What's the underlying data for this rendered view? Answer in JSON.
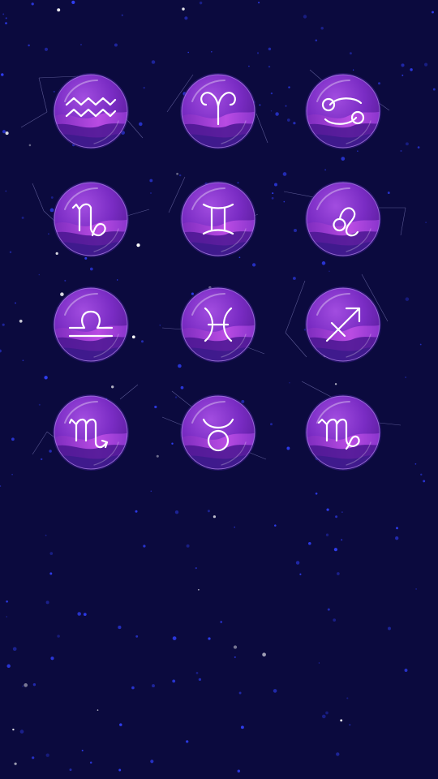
{
  "colors": {
    "background": "#0b0a3e",
    "star_blue": "#2f3df0",
    "star_white": "#ffffff",
    "orb_top": "#a24de0",
    "orb_bottom": "#5a1c9c",
    "wave_pink": "#c04fe6",
    "glyph": "#ffffff"
  },
  "signs": [
    {
      "name": "aquarius",
      "icon": "aquarius-icon"
    },
    {
      "name": "aries",
      "icon": "aries-icon"
    },
    {
      "name": "cancer",
      "icon": "cancer-icon"
    },
    {
      "name": "capricorn",
      "icon": "capricorn-icon"
    },
    {
      "name": "gemini",
      "icon": "gemini-icon"
    },
    {
      "name": "leo",
      "icon": "leo-icon"
    },
    {
      "name": "libra",
      "icon": "libra-icon"
    },
    {
      "name": "pisces",
      "icon": "pisces-icon"
    },
    {
      "name": "sagittarius",
      "icon": "sagittarius-icon"
    },
    {
      "name": "scorpio",
      "icon": "scorpio-icon"
    },
    {
      "name": "taurus",
      "icon": "taurus-icon"
    },
    {
      "name": "virgo",
      "icon": "virgo-icon"
    }
  ]
}
